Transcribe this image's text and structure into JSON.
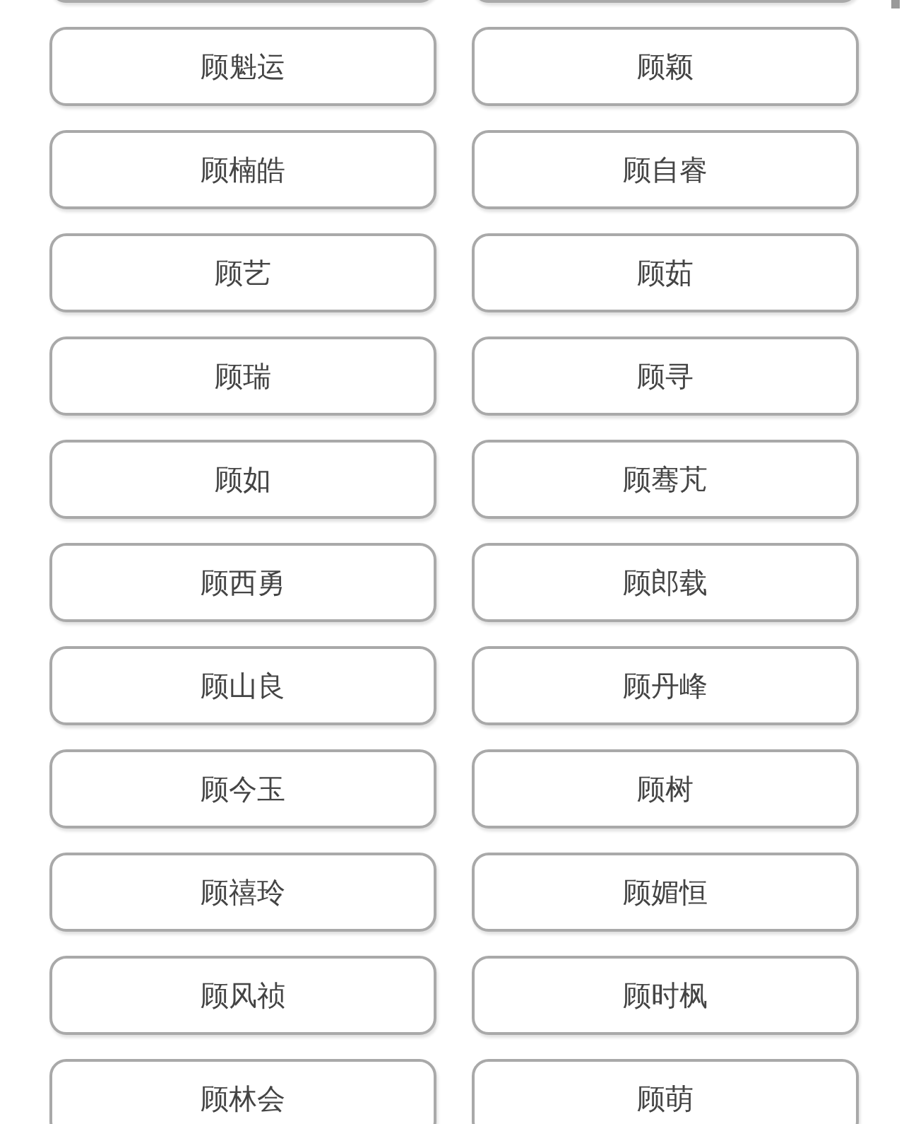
{
  "names": [
    {
      "label": "顾魁运"
    },
    {
      "label": "顾颖"
    },
    {
      "label": "顾楠皓"
    },
    {
      "label": "顾自睿"
    },
    {
      "label": "顾艺"
    },
    {
      "label": "顾茹"
    },
    {
      "label": "顾瑞"
    },
    {
      "label": "顾寻"
    },
    {
      "label": "顾如"
    },
    {
      "label": "顾骞芃"
    },
    {
      "label": "顾西勇"
    },
    {
      "label": "顾郎载"
    },
    {
      "label": "顾山良"
    },
    {
      "label": "顾丹峰"
    },
    {
      "label": "顾今玉"
    },
    {
      "label": "顾树"
    },
    {
      "label": "顾禧玲"
    },
    {
      "label": "顾媚恒"
    },
    {
      "label": "顾风祯"
    },
    {
      "label": "顾时枫"
    },
    {
      "label": "顾林会"
    },
    {
      "label": "顾萌"
    }
  ]
}
